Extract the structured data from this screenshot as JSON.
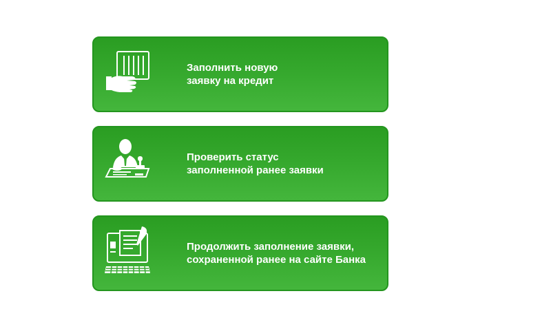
{
  "menu": {
    "items": [
      {
        "icon": "hand-with-barcode-card-icon",
        "line1": "Заполнить новую",
        "line2": "заявку на кредит"
      },
      {
        "icon": "clerk-with-stamp-icon",
        "line1": "Проверить статус",
        "line2": "заполненной ранее заявки"
      },
      {
        "icon": "computer-document-quill-icon",
        "line1": "Продолжить заполнение заявки,",
        "line2": "сохраненной ранее на сайте Банка"
      }
    ]
  },
  "colors": {
    "card_top": "#2a9d22",
    "card_bottom": "#44b63c",
    "card_border": "#23951e",
    "text": "#ffffff"
  }
}
